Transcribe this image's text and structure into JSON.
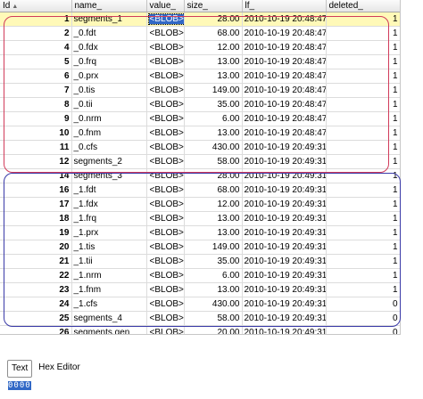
{
  "columns": [
    {
      "label": "Id",
      "sort": "▲"
    },
    {
      "label": "name_",
      "sort": ""
    },
    {
      "label": "value_",
      "sort": ""
    },
    {
      "label": "size_",
      "sort": ""
    },
    {
      "label": "lf_",
      "sort": ""
    },
    {
      "label": "deleted_",
      "sort": ""
    }
  ],
  "rows": [
    {
      "id": "1",
      "name": "segments_1",
      "value": "<BLOB>",
      "size": "28.00",
      "lf": "2010-10-19 20:48:47",
      "deleted": "1"
    },
    {
      "id": "2",
      "name": "_0.fdt",
      "value": "<BLOB>",
      "size": "68.00",
      "lf": "2010-10-19 20:48:47",
      "deleted": "1"
    },
    {
      "id": "4",
      "name": "_0.fdx",
      "value": "<BLOB>",
      "size": "12.00",
      "lf": "2010-10-19 20:48:47",
      "deleted": "1"
    },
    {
      "id": "5",
      "name": "_0.frq",
      "value": "<BLOB>",
      "size": "13.00",
      "lf": "2010-10-19 20:48:47",
      "deleted": "1"
    },
    {
      "id": "6",
      "name": "_0.prx",
      "value": "<BLOB>",
      "size": "13.00",
      "lf": "2010-10-19 20:48:47",
      "deleted": "1"
    },
    {
      "id": "7",
      "name": "_0.tis",
      "value": "<BLOB>",
      "size": "149.00",
      "lf": "2010-10-19 20:48:47",
      "deleted": "1"
    },
    {
      "id": "8",
      "name": "_0.tii",
      "value": "<BLOB>",
      "size": "35.00",
      "lf": "2010-10-19 20:48:47",
      "deleted": "1"
    },
    {
      "id": "9",
      "name": "_0.nrm",
      "value": "<BLOB>",
      "size": "6.00",
      "lf": "2010-10-19 20:48:47",
      "deleted": "1"
    },
    {
      "id": "10",
      "name": "_0.fnm",
      "value": "<BLOB>",
      "size": "13.00",
      "lf": "2010-10-19 20:48:47",
      "deleted": "1"
    },
    {
      "id": "11",
      "name": "_0.cfs",
      "value": "<BLOB>",
      "size": "430.00",
      "lf": "2010-10-19 20:49:31",
      "deleted": "1"
    },
    {
      "id": "12",
      "name": "segments_2",
      "value": "<BLOB>",
      "size": "58.00",
      "lf": "2010-10-19 20:49:31",
      "deleted": "1"
    },
    {
      "id": "14",
      "name": "segments_3",
      "value": "<BLOB>",
      "size": "28.00",
      "lf": "2010-10-19 20:49:31",
      "deleted": "1"
    },
    {
      "id": "16",
      "name": "_1.fdt",
      "value": "<BLOB>",
      "size": "68.00",
      "lf": "2010-10-19 20:49:31",
      "deleted": "1"
    },
    {
      "id": "17",
      "name": "_1.fdx",
      "value": "<BLOB>",
      "size": "12.00",
      "lf": "2010-10-19 20:49:31",
      "deleted": "1"
    },
    {
      "id": "18",
      "name": "_1.frq",
      "value": "<BLOB>",
      "size": "13.00",
      "lf": "2010-10-19 20:49:31",
      "deleted": "1"
    },
    {
      "id": "19",
      "name": "_1.prx",
      "value": "<BLOB>",
      "size": "13.00",
      "lf": "2010-10-19 20:49:31",
      "deleted": "1"
    },
    {
      "id": "20",
      "name": "_1.tis",
      "value": "<BLOB>",
      "size": "149.00",
      "lf": "2010-10-19 20:49:31",
      "deleted": "1"
    },
    {
      "id": "21",
      "name": "_1.tii",
      "value": "<BLOB>",
      "size": "35.00",
      "lf": "2010-10-19 20:49:31",
      "deleted": "1"
    },
    {
      "id": "22",
      "name": "_1.nrm",
      "value": "<BLOB>",
      "size": "6.00",
      "lf": "2010-10-19 20:49:31",
      "deleted": "1"
    },
    {
      "id": "23",
      "name": "_1.fnm",
      "value": "<BLOB>",
      "size": "13.00",
      "lf": "2010-10-19 20:49:31",
      "deleted": "1"
    },
    {
      "id": "24",
      "name": "_1.cfs",
      "value": "<BLOB>",
      "size": "430.00",
      "lf": "2010-10-19 20:49:31",
      "deleted": "0"
    },
    {
      "id": "25",
      "name": "segments_4",
      "value": "<BLOB>",
      "size": "58.00",
      "lf": "2010-10-19 20:49:31",
      "deleted": "0"
    },
    {
      "id": "26",
      "name": "segments.gen",
      "value": "<BLOB>",
      "size": "20.00",
      "lf": "2010-10-19 20:49:31",
      "deleted": "0"
    }
  ],
  "editor_tabs": [
    "Text",
    "Hex Editor"
  ],
  "hex_preview": "0000",
  "colors": {
    "selected_row": "#fff9b8",
    "group_red": "#d13b5a",
    "group_blue": "#3a3aa8",
    "focus_cell": "#3168c6"
  }
}
